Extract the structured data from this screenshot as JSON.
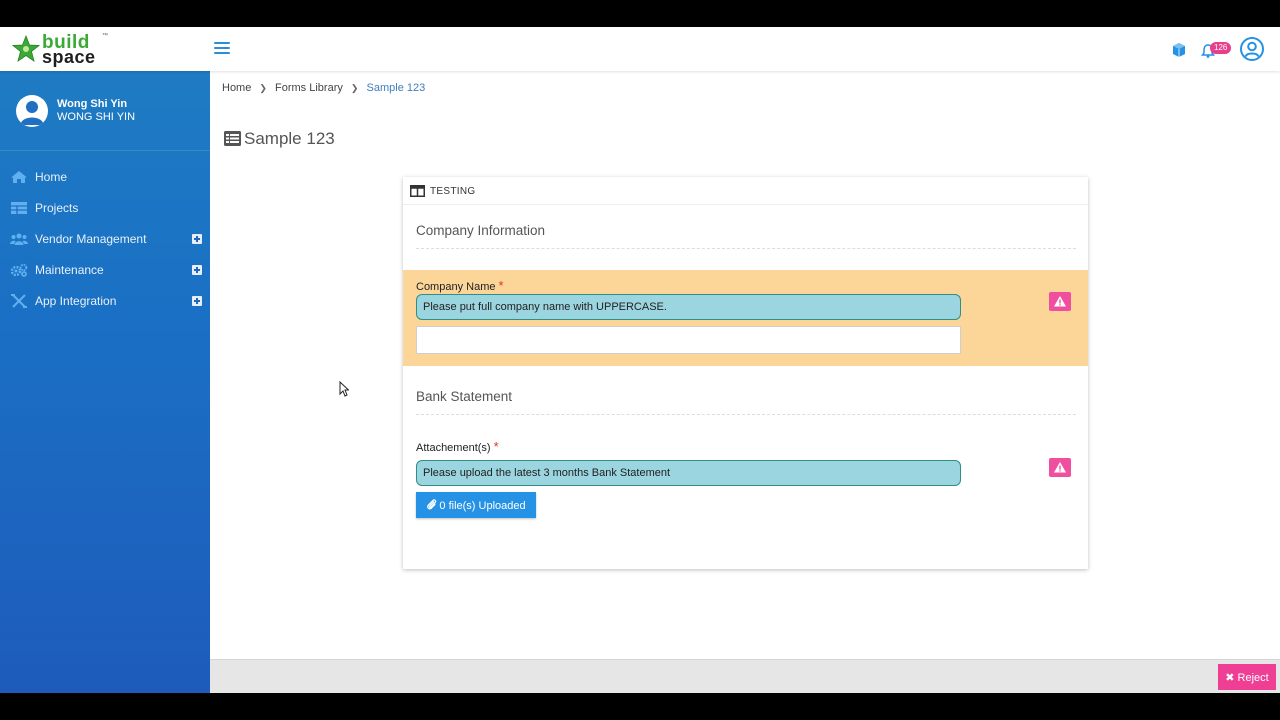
{
  "brand": {
    "line1": "build",
    "line2": "space",
    "tm": "™"
  },
  "topbar": {
    "notification_count": "126"
  },
  "user": {
    "name": "Wong Shi Yin",
    "id": "WONG SHI YIN"
  },
  "sidebar": {
    "items": [
      {
        "label": "Home",
        "icon": "home-icon",
        "expandable": false
      },
      {
        "label": "Projects",
        "icon": "table-icon",
        "expandable": false
      },
      {
        "label": "Vendor Management",
        "icon": "users-icon",
        "expandable": true
      },
      {
        "label": "Maintenance",
        "icon": "gears-icon",
        "expandable": true
      },
      {
        "label": "App Integration",
        "icon": "integration-icon",
        "expandable": true
      }
    ]
  },
  "breadcrumb": {
    "items": [
      "Home",
      "Forms Library",
      "Sample 123"
    ]
  },
  "page": {
    "title": "Sample 123"
  },
  "form": {
    "header": "TESTING",
    "sections": [
      {
        "title": "Company Information",
        "field": {
          "label": "Company Name",
          "required_mark": "*",
          "hint": "Please put full company name with UPPERCASE.",
          "value": ""
        }
      },
      {
        "title": "Bank Statement",
        "field": {
          "label": "Attachement(s)",
          "required_mark": "*",
          "hint": "Please upload the latest 3 months Bank Statement",
          "upload_label": "0 file(s) Uploaded"
        }
      }
    ]
  },
  "footer": {
    "reject_label": "Reject",
    "reject_glyph": "✖"
  },
  "colors": {
    "sidebar": "#1a70c4",
    "accent": "#2592e6",
    "warning_bg": "#fcd699",
    "hint_bg": "#9bd5df",
    "danger": "#ee3f94"
  }
}
